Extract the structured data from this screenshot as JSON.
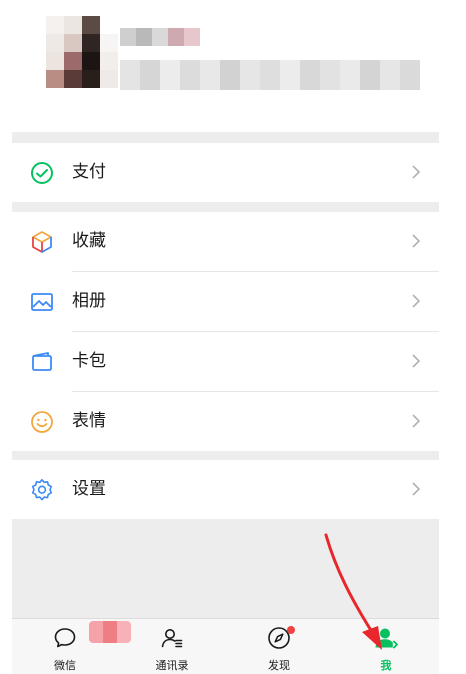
{
  "menu": {
    "pay": {
      "label": "支付",
      "icon": "wallet-check-icon"
    },
    "favorites": {
      "label": "收藏",
      "icon": "cube-icon"
    },
    "album": {
      "label": "相册",
      "icon": "image-icon"
    },
    "cards": {
      "label": "卡包",
      "icon": "card-wallet-icon"
    },
    "stickers": {
      "label": "表情",
      "icon": "smiley-icon"
    },
    "settings": {
      "label": "设置",
      "icon": "gear-icon"
    }
  },
  "tabs": [
    {
      "label": "微信",
      "icon": "chat-bubble-icon"
    },
    {
      "label": "通讯录",
      "icon": "contacts-icon"
    },
    {
      "label": "发现",
      "icon": "compass-icon"
    },
    {
      "label": "我",
      "icon": "person-icon",
      "active": true
    }
  ],
  "colors": {
    "accent_green": "#07c160",
    "annotation_red": "#e8262b",
    "background": "#ededed"
  }
}
